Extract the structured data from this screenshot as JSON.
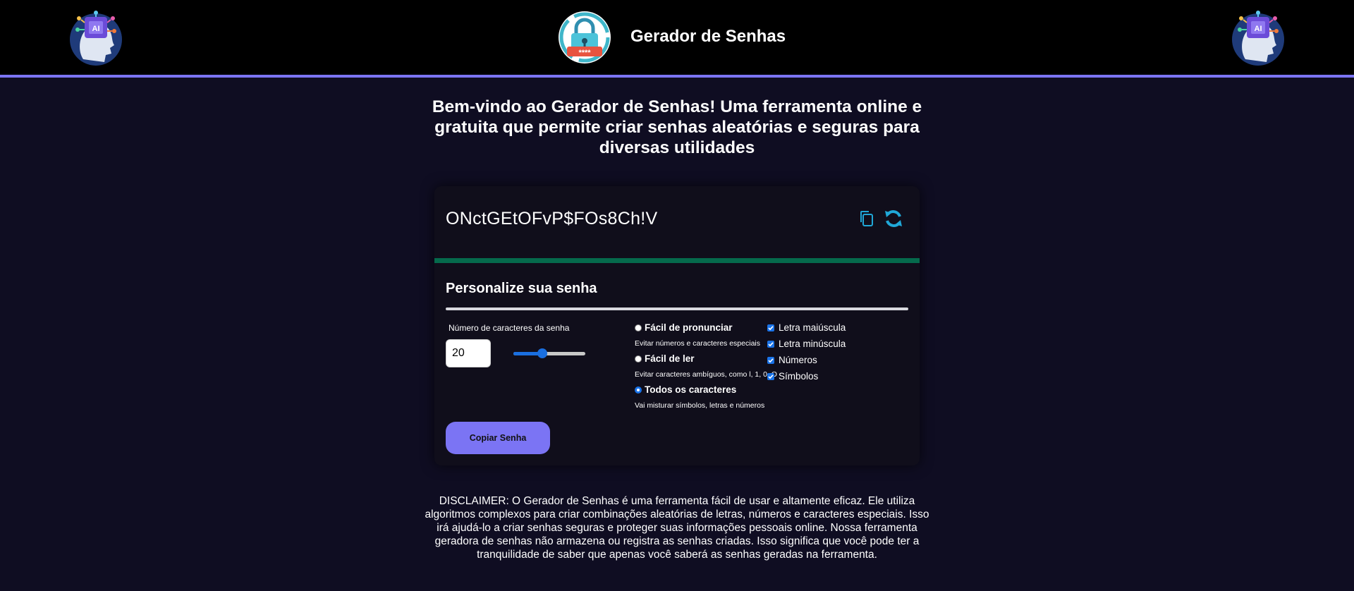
{
  "header": {
    "title": "Gerador de Senhas",
    "ai_logo_text": "AI",
    "lock_logo_text": "****"
  },
  "welcome": {
    "text": "Bem-vindo ao Gerador de Senhas! Uma ferramenta online e gratuita que permite criar senhas aleatórias e seguras para diversas utilidades"
  },
  "generator": {
    "password": "ONctGEtOFvP$FOs8Ch!V",
    "strength_color": "#056a4c",
    "copy_icon": "copy-icon",
    "refresh_icon": "refresh-icon"
  },
  "customize": {
    "title": "Personalize sua senha",
    "length_label": "Número de caracteres da senha",
    "length_value": "20",
    "length_slider_fraction": 0.4,
    "radio_options": [
      {
        "label": "Fácil de pronunciar",
        "description": "Evitar números e caracteres especiais",
        "checked": false
      },
      {
        "label": "Fácil de ler",
        "description": "Evitar caracteres ambíguos, como l, 1, 0, O",
        "checked": false
      },
      {
        "label": "Todos os caracteres",
        "description": "Vai misturar símbolos, letras e números",
        "checked": true
      }
    ],
    "checkboxes": [
      {
        "label": "Letra maiúscula",
        "checked": true
      },
      {
        "label": "Letra minúscula",
        "checked": true
      },
      {
        "label": "Números",
        "checked": true
      },
      {
        "label": "Símbolos",
        "checked": true
      }
    ],
    "copy_button_label": "Copiar Senha"
  },
  "disclaimer": {
    "text": "DISCLAIMER: O Gerador de Senhas é uma ferramenta fácil de usar e altamente eficaz. Ele utiliza algoritmos complexos para criar combinações aleatórias de letras, números e caracteres especiais. Isso irá ajudá-lo a criar senhas seguras e proteger suas informações pessoais online. Nossa ferramenta geradora de senhas não armazena ou registra as senhas criadas. Isso significa que você pode ter a tranquilidade de saber que apenas você saberá as senhas geradas na ferramenta."
  },
  "colors": {
    "accent": "#7b74f4",
    "background": "#0f0d22",
    "card": "#100e1b",
    "strength": "#056a4c",
    "refresh": "#20a8d8"
  }
}
